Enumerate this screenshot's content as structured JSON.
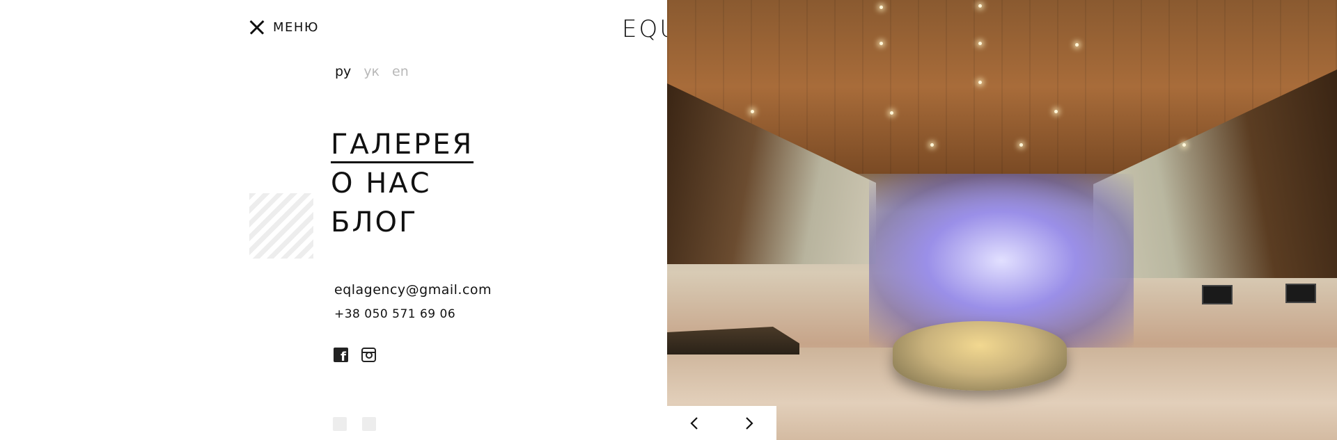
{
  "header": {
    "menu_label": "МЕНЮ",
    "logo_text": "EQUAL"
  },
  "languages": [
    {
      "label": "ру",
      "active": true
    },
    {
      "label": "ук",
      "active": false
    },
    {
      "label": "en",
      "active": false
    }
  ],
  "nav": {
    "items": [
      {
        "label": "ГАЛЕРЕЯ",
        "current": true
      },
      {
        "label": "О НАС",
        "current": false
      },
      {
        "label": "БЛОГ",
        "current": false
      }
    ]
  },
  "contacts": {
    "email": "eqlagency@gmail.com",
    "phone": "+38 050 571 69 06"
  },
  "social": {
    "icons": [
      "facebook-icon",
      "instagram-icon"
    ]
  },
  "slider": {
    "prev_icon": "chevron-left-icon",
    "next_icon": "chevron-right-icon"
  },
  "colors": {
    "text": "#111111",
    "inactive_lang": "#b8b8b8",
    "background": "#ffffff"
  }
}
